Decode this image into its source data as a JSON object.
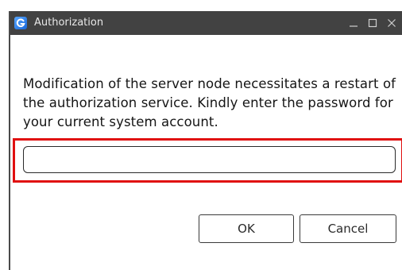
{
  "window": {
    "title": "Authorization",
    "app_icon": "app-g-logo-icon",
    "controls": {
      "minimize_icon": "minimize-icon",
      "maximize_icon": "maximize-icon",
      "close_icon": "close-icon"
    }
  },
  "dialog": {
    "message": "Modification of the server node necessitates a restart of the authorization service. Kindly enter the password for your current system account.",
    "password_field": {
      "value": "",
      "placeholder": ""
    },
    "buttons": {
      "ok_label": "OK",
      "cancel_label": "Cancel"
    }
  },
  "colors": {
    "titlebar": "#424242",
    "highlight_border": "#e01010",
    "icon_blue": "#1766d8"
  }
}
